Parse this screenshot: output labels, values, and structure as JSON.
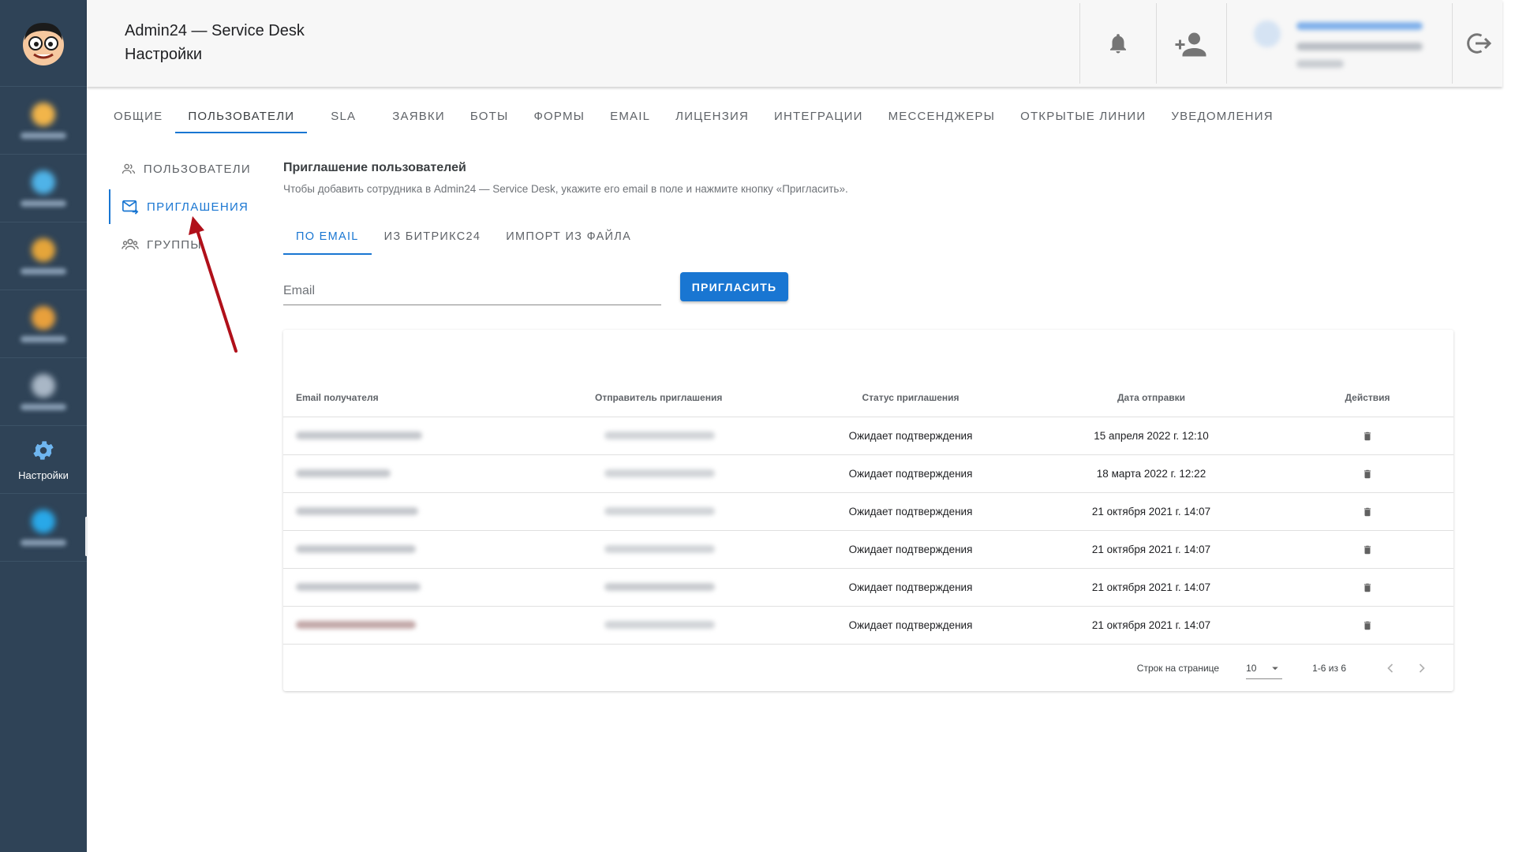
{
  "app": {
    "title": "Admin24 — Service Desk",
    "subtitle": "Настройки"
  },
  "rail": {
    "active_item": {
      "label": "Настройки",
      "icon": "gear-icon"
    },
    "blurred_item_colors": [
      "#f2b54a",
      "#4fb3e8",
      "#e5a53a",
      "#e8a03c",
      "#a9b7c6",
      "#29a8e8"
    ]
  },
  "header": {
    "notification_icon": "bell-icon",
    "add_user_icon": "person-add-icon",
    "logout_icon": "logout-icon"
  },
  "top_tabs": [
    {
      "label": "Общие"
    },
    {
      "label": "Пользователи"
    },
    {
      "label": "SLA"
    },
    {
      "label": "Заявки"
    },
    {
      "label": "Боты"
    },
    {
      "label": "Формы"
    },
    {
      "label": "Email"
    },
    {
      "label": "Лицензия"
    },
    {
      "label": "Интеграции"
    },
    {
      "label": "Мессенджеры"
    },
    {
      "label": "Открытые линии"
    },
    {
      "label": "Уведомления"
    }
  ],
  "side_menu": [
    {
      "label": "Пользователи",
      "icon": "users-icon"
    },
    {
      "label": "Приглашения",
      "icon": "mail-forward-icon"
    },
    {
      "label": "Группы",
      "icon": "groups-icon"
    }
  ],
  "content": {
    "title": "Приглашение пользователей",
    "description": "Чтобы добавить сотрудника в Admin24 — Service Desk, укажите его email в поле и нажмите кнопку «Пригласить».",
    "sub_tabs": [
      {
        "label": "По email"
      },
      {
        "label": "Из Битрикс24"
      },
      {
        "label": "Импорт из файла"
      }
    ],
    "email_placeholder": "Email",
    "invite_button": "Пригласить"
  },
  "table": {
    "headers": {
      "email": "Email получателя",
      "sender": "Отправитель приглашения",
      "status": "Статус приглашения",
      "date": "Дата отправки",
      "actions": "Действия"
    },
    "rows": [
      {
        "status": "Ожидает подтверждения",
        "date": "15 апреля 2022 г. 12:10"
      },
      {
        "status": "Ожидает подтверждения",
        "date": "18 марта 2022 г. 12:22"
      },
      {
        "status": "Ожидает подтверждения",
        "date": "21 октября 2021 г. 14:07"
      },
      {
        "status": "Ожидает подтверждения",
        "date": "21 октября 2021 г. 14:07"
      },
      {
        "status": "Ожидает подтверждения",
        "date": "21 октября 2021 г. 14:07"
      },
      {
        "status": "Ожидает подтверждения",
        "date": "21 октября 2021 г. 14:07"
      }
    ],
    "pagination": {
      "rows_per_page_label": "Строк на странице",
      "rows_per_page": "10",
      "range": "1-6 из 6"
    }
  },
  "colors": {
    "accent": "#1976d2",
    "rail_bg": "#2f4357",
    "annotation_arrow": "#b0101a"
  }
}
